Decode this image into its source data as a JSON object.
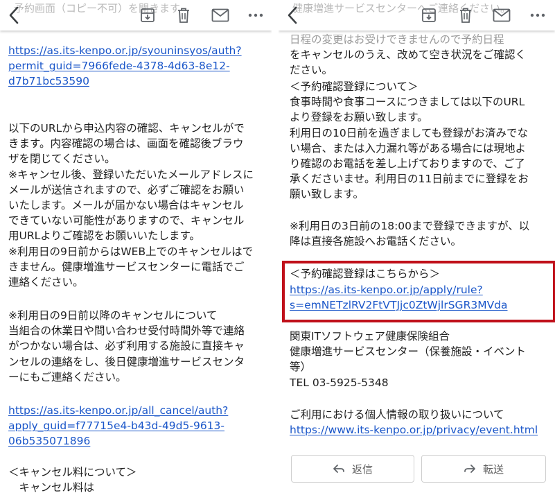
{
  "left": {
    "header_ghost": "予約画面（コピー不可）を開きます",
    "link1": [
      "https://as.its-kenpo.or.jp/syouninsyos/auth?",
      "permit_guid=7966fede-4378-4d63-8e12-",
      "d7b71bc53590"
    ],
    "para1": [
      "以下のURLから申込内容の確認、キャンセルがで",
      "きます。内容確認の場合は、画面を確認後ブラウ",
      "ザを閉じてください。",
      "※キャンセル後、登録いただいたメールアドレスに",
      "メールが送信されますので、必ずご確認をお願い",
      "いたします。メールが届かない場合はキャンセル",
      "できていない可能性がありますので、キャンセル",
      "用URLよりご確認をお願いいたします。",
      "※利用日の9日前からはWEB上でのキャンセルはで",
      "きません。健康増進サービスセンターに電話でご",
      "連絡ください。"
    ],
    "para2": [
      "※利用日の9日前以降のキャンセルについて",
      "当組合の休業日や問い合わせ受付時間外等で連絡",
      "がつかない場合は、必ず利用する施設に直接キャ",
      "ンセルの連絡をし、後日健康増進サービスセンタ",
      "ーにもご連絡ください。"
    ],
    "link2": [
      "https://as.its-kenpo.or.jp/all_cancel/auth?",
      "apply_guid=f77715e4-b43d-49d5-9613-",
      "06b535071896"
    ],
    "para3": [
      "＜キャンセル料について＞",
      "　キャンセル料は"
    ]
  },
  "right": {
    "header_ghost": [
      "健康増進サービスセンターへご連絡ください。",
      "日程の変更はお受けできませんので予約日程",
      "をキャンセルのうえ、改めて空き状況をご確認く",
      "ださい。"
    ],
    "para1": [
      "＜予約確認登録について＞",
      "食事時間や食事コースにつきましては以下のURL",
      "より登録をお願い致します。",
      "利用日の10日前を過ぎましても登録がお済みでな",
      "い場合、または入力漏れ等がある場合には現地よ",
      "り確認のお電話を差し上げておりますので、ご了",
      "承くださいませ。利用日の11日前までに登録をお",
      "願い致します。"
    ],
    "para2": [
      "※利用日の3日前の18:00まで登録できますが、以",
      "降は直接各施設へお電話ください。"
    ],
    "box_title": "＜予約確認登録はこちらから＞",
    "box_link": [
      "https://as.its-kenpo.or.jp/apply/rule?",
      "s=emNETzlRV2FtVTJjc0ZtWjlrSGR3MVda"
    ],
    "org": [
      "関東ITソフトウェア健康保険組合",
      "健康増進サービスセンター（保養施設・イベント",
      "等）",
      "TEL 03-5925-5348"
    ],
    "privacy_title": "ご利用における個人情報の取り扱いについて",
    "privacy_link": "https://www.its-kenpo.or.jp/privacy/event.html",
    "reply_label": "返信",
    "forward_label": "転送"
  },
  "toolbar_icons": [
    "back-chevron-icon",
    "archive-icon",
    "trash-icon",
    "mail-icon",
    "more-icon"
  ],
  "colors": {
    "link": "#1a56c9",
    "highlight": "#c0101a",
    "text": "#1f1f1f",
    "icon": "#5f6368"
  }
}
